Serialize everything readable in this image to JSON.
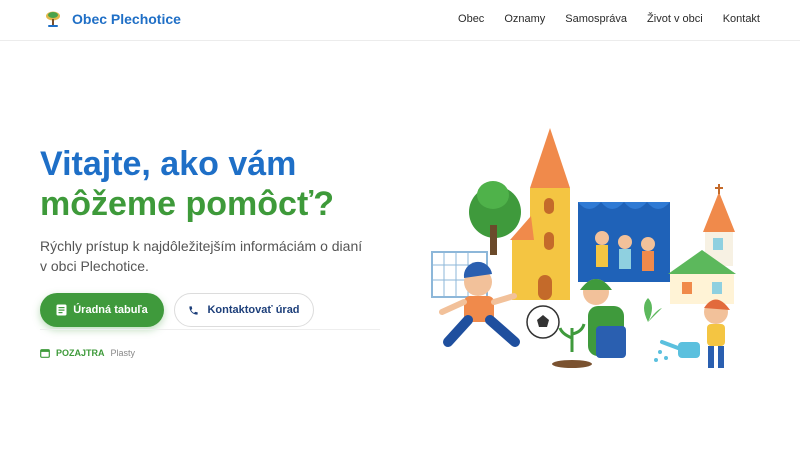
{
  "header": {
    "brand": "Obec Plechotice",
    "nav": [
      "Obec",
      "Oznamy",
      "Samospráva",
      "Život v obci",
      "Kontakt"
    ]
  },
  "hero": {
    "title_line1": "Vitajte, ako vám",
    "title_line2": "môžeme pomôcť?",
    "lead": "Rýchly prístup k najdôležitejším informáciám o dianí v obci Plechotice.",
    "primary_button": "Úradná tabuľa",
    "secondary_button": "Kontaktovať úrad"
  },
  "notice": {
    "when": "POZAJTRA",
    "what": "Plasty"
  },
  "colors": {
    "blue": "#1e6fc7",
    "green": "#3e9a3a",
    "navy": "#1d3f7a"
  }
}
